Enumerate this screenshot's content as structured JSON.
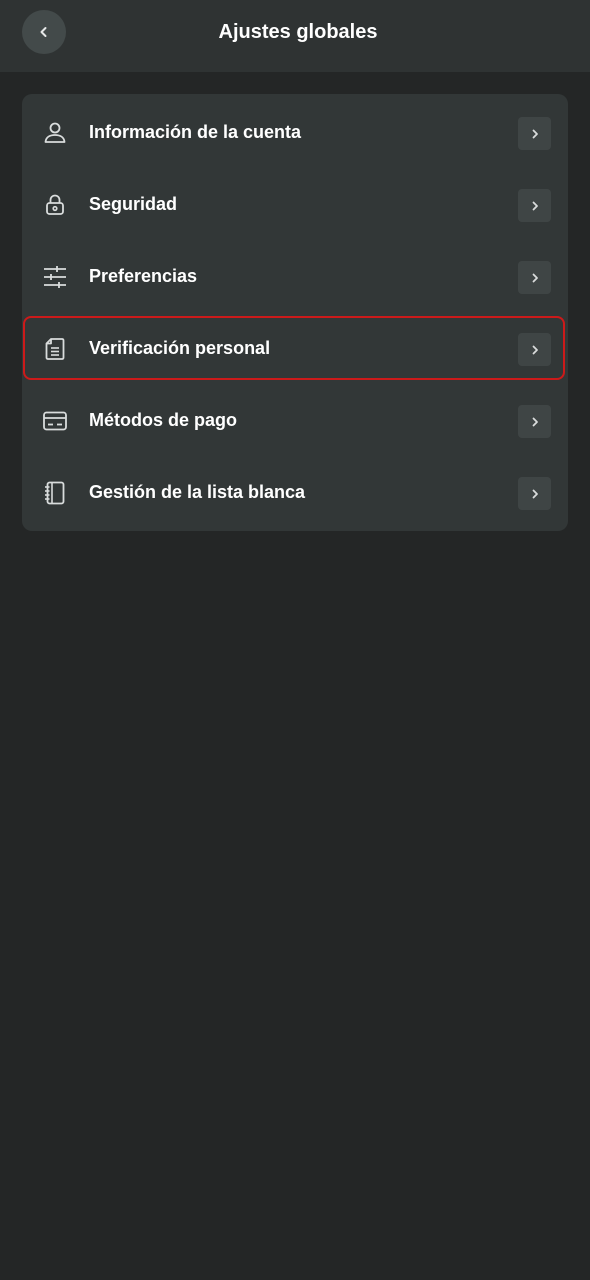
{
  "header": {
    "title": "Ajustes globales",
    "back_icon": "chevron-left-icon"
  },
  "settings": {
    "items": [
      {
        "label": "Información de la cuenta",
        "icon": "user-icon"
      },
      {
        "label": "Seguridad",
        "icon": "lock-icon"
      },
      {
        "label": "Preferencias",
        "icon": "sliders-icon"
      },
      {
        "label": "Verificación personal",
        "icon": "document-icon",
        "highlighted": true
      },
      {
        "label": "Métodos de pago",
        "icon": "credit-card-icon"
      },
      {
        "label": "Gestión de la lista blanca",
        "icon": "notebook-icon"
      }
    ],
    "chevron_icon": "chevron-right-icon"
  },
  "colors": {
    "background": "#242626",
    "header_bg": "#2f3333",
    "card_bg": "#323737",
    "highlight_border": "#cc1a1a",
    "text": "#ffffff",
    "icon": "#d9dcdc"
  }
}
